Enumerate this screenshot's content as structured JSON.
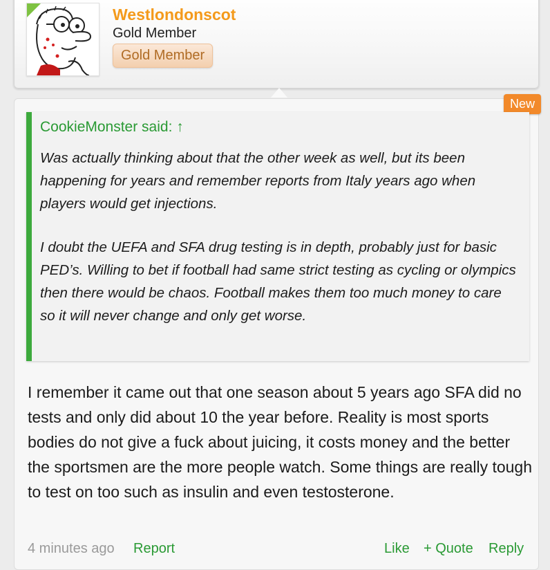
{
  "user": {
    "name": "Westlondonscot",
    "title": "Gold Member",
    "banner": "Gold Member"
  },
  "post": {
    "badge": "New",
    "quote": {
      "author": "CookieMonster said: ↑",
      "paragraphs": [
        "Was actually thinking about that the other week as well, but its been happening for years and remember reports from Italy years ago when players would get injections.",
        "I doubt the UEFA and SFA drug testing is in depth, probably just for basic PED’s. Willing to bet if football had same strict testing as cycling or olympics then there would be chaos. Football makes them too much money to care so it will never change and only get worse."
      ]
    },
    "body": "I remember it came out that one season about 5 years ago SFA did no tests and only did about 10 the year before. Reality is most sports bodies do not give a fuck about juicing, it costs money and the better the sportsmen are the more people watch. Some things are really tough to test on too such as insulin and even testosterone.",
    "footer": {
      "time": "4 minutes ago",
      "report": "Report",
      "like": "Like",
      "quote": "+ Quote",
      "reply": "Reply"
    }
  },
  "colors": {
    "username": "#f49a1b",
    "quote_accent": "#3daa3d",
    "new_badge": "#f2892a",
    "link": "#2a9a34"
  }
}
